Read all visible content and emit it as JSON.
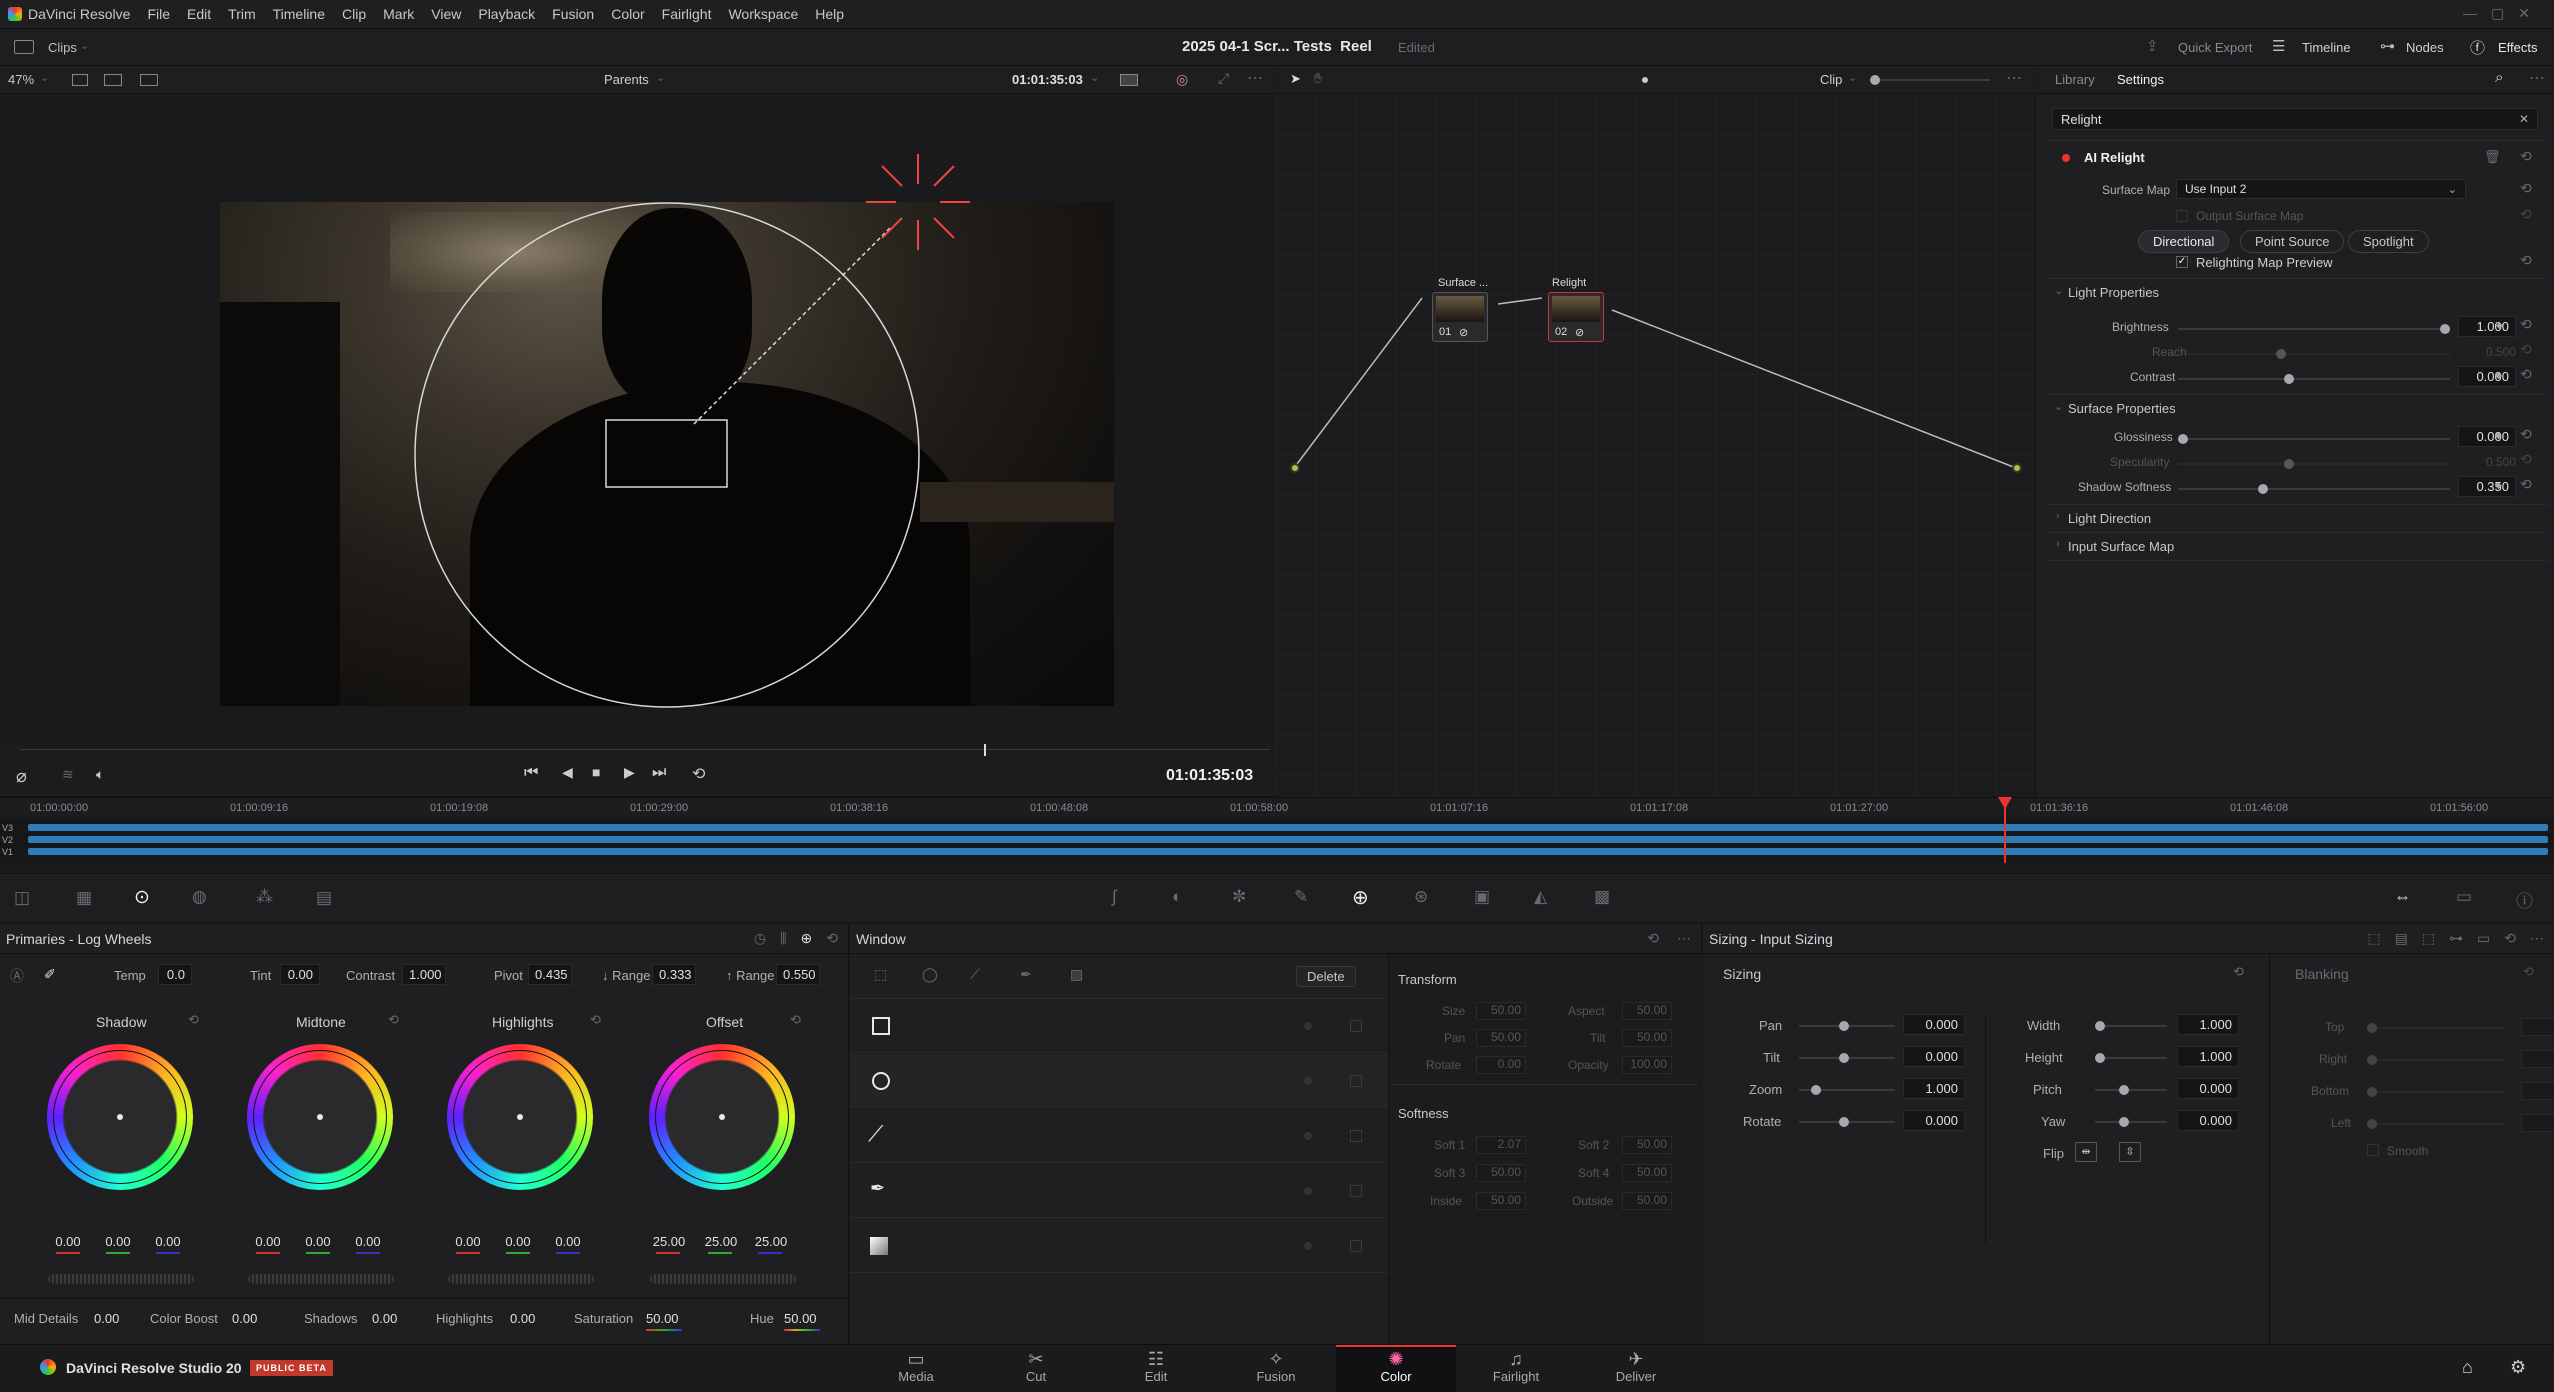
{
  "menu": {
    "app": "DaVinci Resolve",
    "items": [
      "File",
      "Edit",
      "Trim",
      "Timeline",
      "Clip",
      "Mark",
      "View",
      "Playback",
      "Fusion",
      "Color",
      "Fairlight",
      "Workspace",
      "Help"
    ]
  },
  "header": {
    "clips_label": "Clips",
    "project_title": "2025 04-1 Scr... Tests  Reel",
    "status": "Edited",
    "quick_export": "Quick Export",
    "timeline": "Timeline",
    "nodes": "Nodes",
    "effects": "Effects"
  },
  "viewer": {
    "zoom": "47%",
    "parents": "Parents",
    "timecode_top": "01:01:35:03",
    "timecode": "01:01:35:03"
  },
  "nodegraph": {
    "clip_label": "Clip",
    "node1_label": "Surface ...",
    "node1_num": "01",
    "node2_label": "Relight",
    "node2_num": "02"
  },
  "inspector": {
    "tab_library": "Library",
    "tab_settings": "Settings",
    "search": "Relight",
    "effect_name": "AI Relight",
    "surface_map_label": "Surface Map",
    "surface_map_value": "Use Input 2",
    "output_surface_map": "Output Surface Map",
    "modes": [
      "Directional",
      "Point Source",
      "Spotlight"
    ],
    "relight_preview": "Relighting Map Preview",
    "light_props": "Light Properties",
    "brightness_label": "Brightness",
    "brightness": "1.000",
    "reach_label": "Reach",
    "reach": "0.500",
    "contrast_label": "Contrast",
    "contrast": "0.000",
    "surface_props": "Surface Properties",
    "gloss_label": "Glossiness",
    "gloss": "0.000",
    "spec_label": "Specularity",
    "spec": "0.500",
    "shadow_soft_label": "Shadow Softness",
    "shadow_soft": "0.350",
    "light_dir": "Light Direction",
    "input_surface": "Input Surface Map"
  },
  "ruler": [
    "01:00:00:00",
    "01:00:09:16",
    "01:00:19:08",
    "01:00:29:00",
    "01:00:38:16",
    "01:00:48:08",
    "01:00:58:00",
    "01:01:07:16",
    "01:01:17:08",
    "01:01:27:00",
    "01:01:36:16",
    "01:01:46:08",
    "01:01:56:00"
  ],
  "tracks": [
    "V3",
    "V2",
    "V1"
  ],
  "primaries": {
    "title": "Primaries - Log Wheels",
    "temp_label": "Temp",
    "temp": "0.0",
    "tint_label": "Tint",
    "tint": "0.00",
    "contrast_label": "Contrast",
    "contrast": "1.000",
    "pivot_label": "Pivot",
    "pivot": "0.435",
    "lrange_label": "↓ Range",
    "lrange": "0.333",
    "hrange_label": "↑ Range",
    "hrange": "0.550",
    "wheels": [
      {
        "name": "Shadow",
        "vals": [
          "0.00",
          "0.00",
          "0.00"
        ]
      },
      {
        "name": "Midtone",
        "vals": [
          "0.00",
          "0.00",
          "0.00"
        ]
      },
      {
        "name": "Highlights",
        "vals": [
          "0.00",
          "0.00",
          "0.00"
        ]
      },
      {
        "name": "Offset",
        "vals": [
          "25.00",
          "25.00",
          "25.00"
        ]
      }
    ],
    "middetail_label": "Mid Details",
    "middetail": "0.00",
    "colorboost_label": "Color Boost",
    "colorboost": "0.00",
    "shadows_label": "Shadows",
    "shadows": "0.00",
    "highlights_label": "Highlights",
    "highlights": "0.00",
    "saturation_label": "Saturation",
    "saturation": "50.00",
    "hue_label": "Hue",
    "hue": "50.00"
  },
  "window": {
    "title": "Window",
    "delete": "Delete",
    "transform": "Transform",
    "size_label": "Size",
    "size": "50.00",
    "aspect_label": "Aspect",
    "aspect": "50.00",
    "pan_label": "Pan",
    "pan": "50.00",
    "tilt_label": "Tilt",
    "tilt": "50.00",
    "rotate_label": "Rotate",
    "rotate": "0.00",
    "opacity_label": "Opacity",
    "opacity": "100.00",
    "softness": "Softness",
    "soft1_label": "Soft 1",
    "soft1": "2.07",
    "soft2_label": "Soft 2",
    "soft2": "50.00",
    "soft3_label": "Soft 3",
    "soft3": "50.00",
    "soft4_label": "Soft 4",
    "soft4": "50.00",
    "inside_label": "Inside",
    "inside": "50.00",
    "outside_label": "Outside",
    "outside": "50.00"
  },
  "sizing": {
    "title": "Sizing - Input Sizing",
    "section": "Sizing",
    "blanking": "Blanking",
    "pan_label": "Pan",
    "pan": "0.000",
    "tilt_label": "Tilt",
    "tilt": "0.000",
    "zoom_label": "Zoom",
    "zoom": "1.000",
    "rotate_label": "Rotate",
    "rotate": "0.000",
    "width_label": "Width",
    "width": "1.000",
    "height_label": "Height",
    "height": "1.000",
    "pitch_label": "Pitch",
    "pitch": "0.000",
    "yaw_label": "Yaw",
    "yaw": "0.000",
    "flip_label": "Flip",
    "top_label": "Top",
    "right_label": "Right",
    "bottom_label": "Bottom",
    "left_label": "Left",
    "smooth_label": "Smooth"
  },
  "footer": {
    "app": "DaVinci Resolve Studio 20",
    "beta": "PUBLIC BETA",
    "pages": [
      "Media",
      "Cut",
      "Edit",
      "Fusion",
      "Color",
      "Fairlight",
      "Deliver"
    ],
    "active_page": "Color"
  }
}
